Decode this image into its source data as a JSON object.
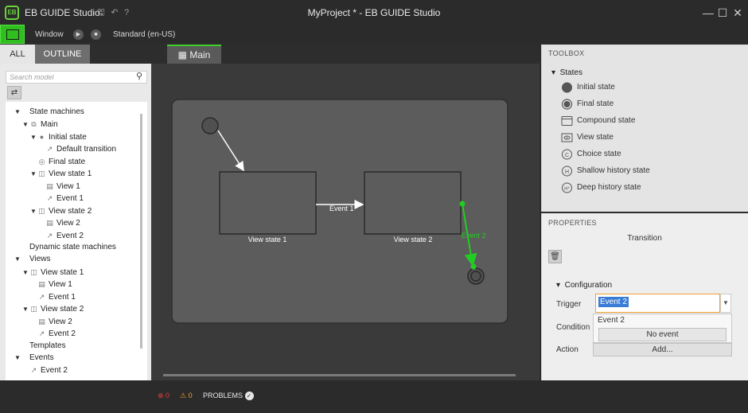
{
  "app": {
    "name": "EB GUIDE Studio",
    "logo_text": "EB",
    "window_title": "MyProject * - EB GUIDE Studio"
  },
  "menubar": {
    "window_label": "Window",
    "locale_label": "Standard (en-US)"
  },
  "left_panel": {
    "tabs": [
      "ALL",
      "OUTLINE"
    ],
    "search_placeholder": "Search model",
    "tree": [
      {
        "label": "State machines",
        "icon": "",
        "expander": "open"
      },
      {
        "label": "Main",
        "icon": "state-machine",
        "expander": "open"
      },
      {
        "label": "Initial state",
        "icon": "initial-state",
        "expander": "open"
      },
      {
        "label": "Default transition",
        "icon": "transition",
        "expander": ""
      },
      {
        "label": "Final state",
        "icon": "final-state",
        "expander": ""
      },
      {
        "label": "View state 1",
        "icon": "view-state",
        "expander": "open"
      },
      {
        "label": "View 1",
        "icon": "view",
        "expander": ""
      },
      {
        "label": "Event 1",
        "icon": "transition",
        "expander": ""
      },
      {
        "label": "View state 2",
        "icon": "view-state",
        "expander": "open"
      },
      {
        "label": "View 2",
        "icon": "view",
        "expander": ""
      },
      {
        "label": "Event 2",
        "icon": "transition",
        "expander": ""
      },
      {
        "label": "Dynamic state machines",
        "icon": "",
        "expander": ""
      },
      {
        "label": "Views",
        "icon": "",
        "expander": "open"
      },
      {
        "label": "View state 1",
        "icon": "view-state",
        "expander": "open"
      },
      {
        "label": "View 1",
        "icon": "view",
        "expander": ""
      },
      {
        "label": "Event 1",
        "icon": "transition",
        "expander": ""
      },
      {
        "label": "View state 2",
        "icon": "view-state",
        "expander": "open"
      },
      {
        "label": "View 2",
        "icon": "view",
        "expander": ""
      },
      {
        "label": "Event 2",
        "icon": "transition",
        "expander": ""
      },
      {
        "label": "Templates",
        "icon": "",
        "expander": ""
      },
      {
        "label": "Events",
        "icon": "",
        "expander": "open"
      },
      {
        "label": "Event 2",
        "icon": "transition",
        "expander": ""
      }
    ]
  },
  "editor": {
    "tab_label": "Main",
    "state_1_label": "View state 1",
    "state_2_label": "View state 2",
    "transition_1_label": "Event 1",
    "transition_2_label": "Event 2",
    "selection_color": "#22cc22"
  },
  "toolbox": {
    "title": "TOOLBOX",
    "group": "States",
    "items": [
      {
        "label": "Initial state",
        "icon": "initial-state-icon"
      },
      {
        "label": "Final state",
        "icon": "final-state-icon"
      },
      {
        "label": "Compound state",
        "icon": "compound-state-icon"
      },
      {
        "label": "View state",
        "icon": "view-state-icon"
      },
      {
        "label": "Choice state",
        "icon": "choice-state-icon"
      },
      {
        "label": "Shallow history state",
        "icon": "shallow-history-icon"
      },
      {
        "label": "Deep history state",
        "icon": "deep-history-icon"
      }
    ]
  },
  "properties": {
    "title": "PROPERTIES",
    "subtitle": "Transition",
    "section": "Configuration",
    "trigger_label": "Trigger",
    "trigger_value": "Event 2",
    "condition_label": "Condition",
    "action_label": "Action",
    "dropdown_options": [
      "Event 2",
      "No event"
    ],
    "add_label": "Add..."
  },
  "statusbar": {
    "errors": "0",
    "warnings": "0",
    "problems_label": "PROBLEMS"
  }
}
